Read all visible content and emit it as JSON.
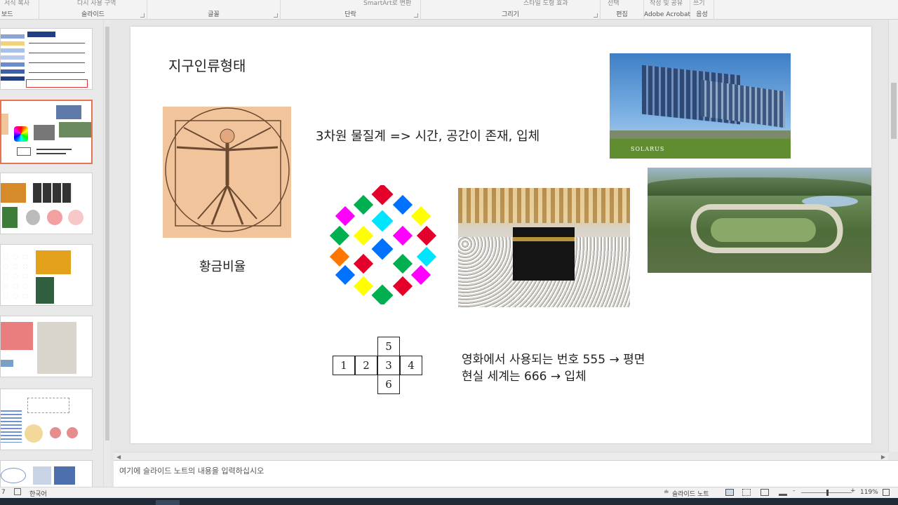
{
  "ribbon": {
    "groups": [
      {
        "label": "보드",
        "top": "서식 복사"
      },
      {
        "label": "슬라이드",
        "top": "다시 사용  구역"
      },
      {
        "label": "글꼴",
        "top": ""
      },
      {
        "label": "단락",
        "top": "SmartArt로 변환"
      },
      {
        "label": "그리기",
        "top": "스타일  도형 효과"
      },
      {
        "label": "편집",
        "top": "선택"
      },
      {
        "label": "Adobe Acrobat",
        "top": "작성 및 공유"
      },
      {
        "label": "음성",
        "top": "쓰기"
      }
    ]
  },
  "slide": {
    "title": "지구인류형태",
    "golden_ratio_label": "황금비율",
    "dimension_text": "3차원 물질계 => 시간, 공간이 존재, 입체",
    "cross_numbers": {
      "top": "5",
      "left1": "1",
      "left2": "2",
      "center": "3",
      "right": "4",
      "bottom": "6"
    },
    "movie_line": "영화에서 사용되는 번호 555 → 평면",
    "real_line": "현실 세계는 666 → 입체",
    "building_caption": "SOLARUS"
  },
  "notes": {
    "placeholder": "여기에 슬라이드 노트의 내용을 입력하십시오"
  },
  "status": {
    "slide_num": "7",
    "language": "한국어",
    "notes_button": "슬라이드 노트",
    "zoom": "119%"
  },
  "colors": {
    "selected_border": "#e8734f",
    "parchment": "#f2c49b",
    "sketch": "#6b4a32"
  }
}
